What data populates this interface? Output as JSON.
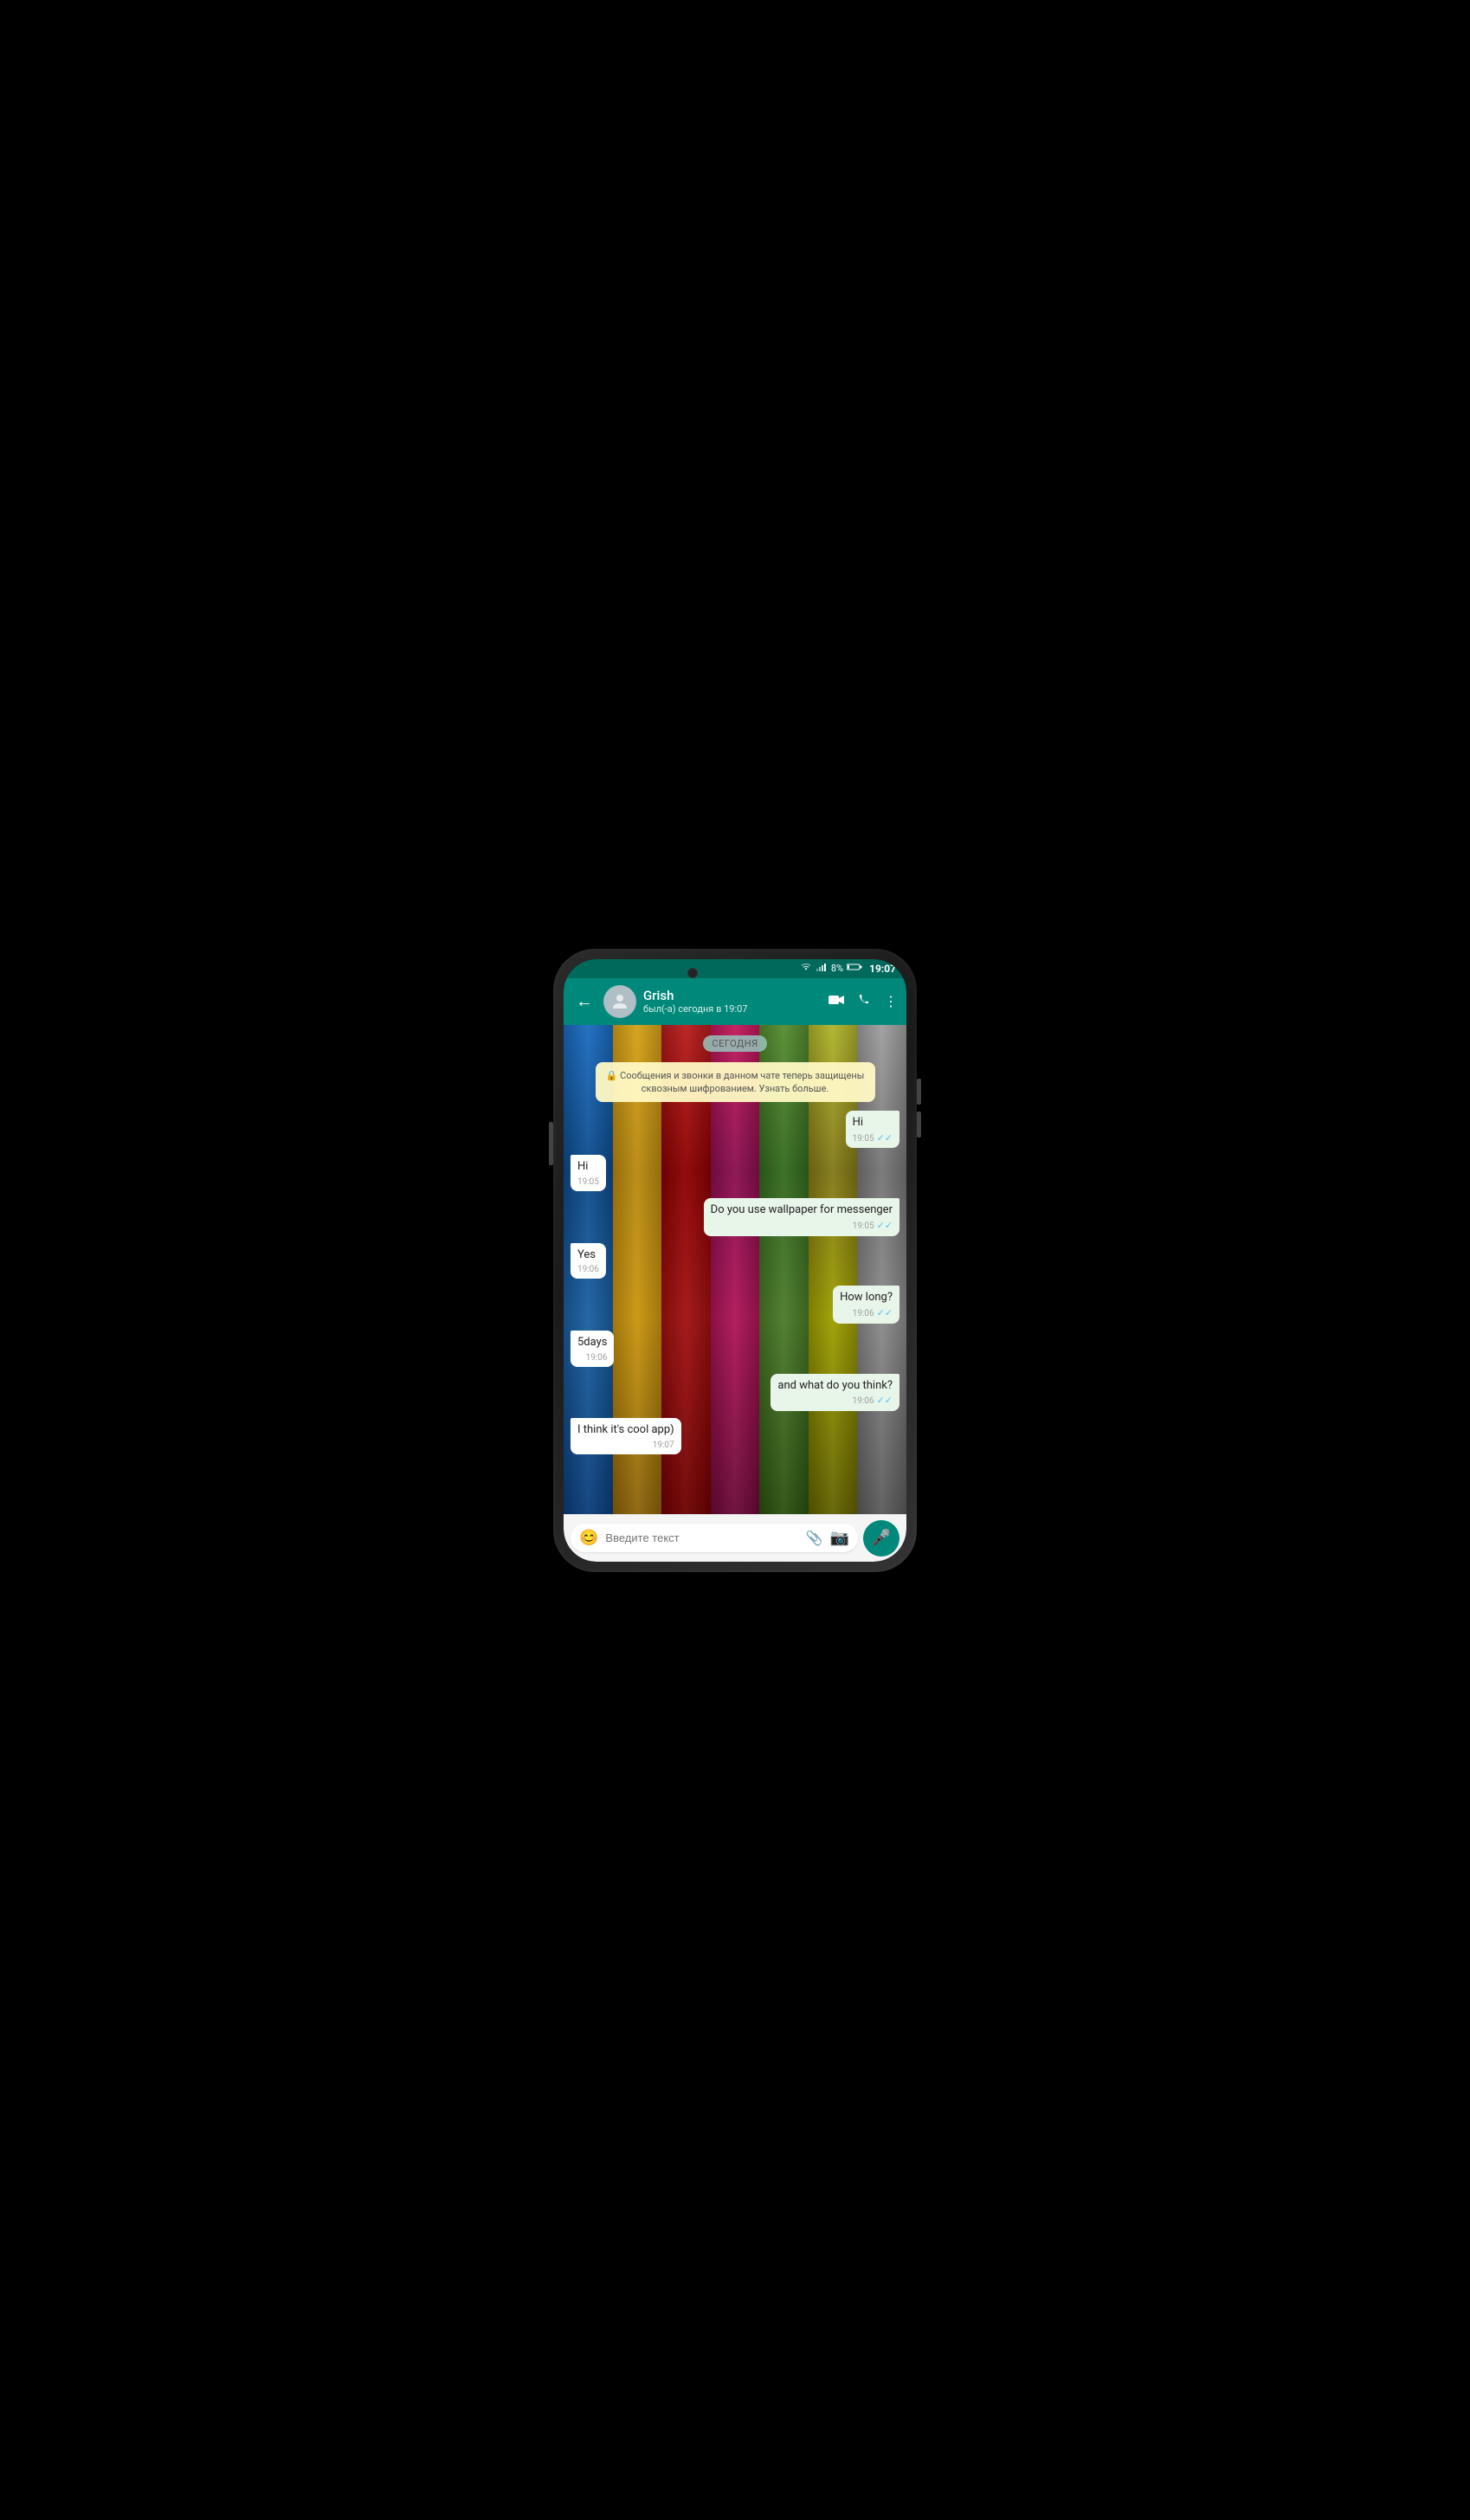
{
  "status_bar": {
    "wifi_icon": "wifi",
    "signal_icon": "signal",
    "battery_percent": "8%",
    "battery_icon": "battery",
    "time": "19:07"
  },
  "app_bar": {
    "back_label": "←",
    "contact_name": "Grish",
    "contact_status": "был(-а) сегодня в 19:07",
    "video_icon": "video",
    "call_icon": "phone",
    "more_icon": "⋮"
  },
  "chat": {
    "date_label": "СЕГОДНЯ",
    "security_notice": "🔒 Сообщения и звонки в данном чате теперь защищены сквозным шифрованием. Узнать больше.",
    "messages": [
      {
        "id": 1,
        "type": "sent",
        "text": "Hi",
        "time": "19:05",
        "read": true
      },
      {
        "id": 2,
        "type": "received",
        "text": "Hi",
        "time": "19:05"
      },
      {
        "id": 3,
        "type": "sent",
        "text": "Do you use wallpaper for messenger",
        "time": "19:05",
        "read": true
      },
      {
        "id": 4,
        "type": "received",
        "text": "Yes",
        "time": "19:06"
      },
      {
        "id": 5,
        "type": "sent",
        "text": "How long?",
        "time": "19:06",
        "read": true
      },
      {
        "id": 6,
        "type": "received",
        "text": "5days",
        "time": "19:06"
      },
      {
        "id": 7,
        "type": "sent",
        "text": "and what do you think?",
        "time": "19:06",
        "read": true
      },
      {
        "id": 8,
        "type": "received",
        "text": "I think it's cool app)",
        "time": "19:07"
      }
    ]
  },
  "input_bar": {
    "placeholder": "Введите текст",
    "emoji_icon": "😊",
    "attach_icon": "📎",
    "camera_icon": "📷",
    "mic_icon": "🎤"
  }
}
